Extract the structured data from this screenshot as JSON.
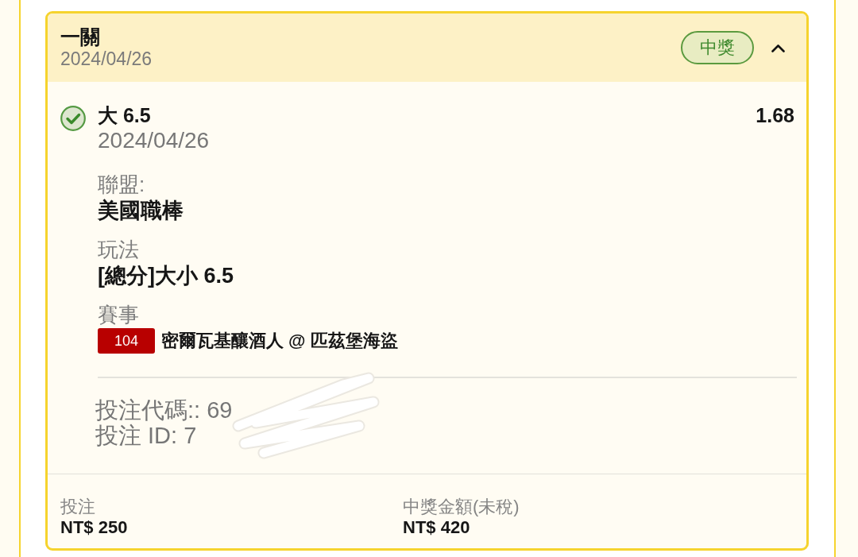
{
  "bet": {
    "type": "一關",
    "date": "2024/04/26",
    "status": "中獎",
    "expanded": true
  },
  "legs": [
    {
      "won": true,
      "selection": "大 6.5",
      "odds": "1.68",
      "date": "2024/04/26",
      "fields": [
        {
          "label": "聯盟:",
          "value": "美國職棒"
        },
        {
          "label": "玩法",
          "value": "[總分]大小 6.5"
        }
      ],
      "event": {
        "label": "賽事",
        "number": "104",
        "teams": "密爾瓦基釀酒人 @ 匹茲堡海盜"
      }
    }
  ],
  "codes": [
    "投注代碼:: 69",
    "投注 ID: 7"
  ],
  "summary": [
    {
      "label": "投注",
      "value": "NT$ 250"
    },
    {
      "label": "中獎金額(未稅)",
      "value": "NT$ 420"
    }
  ]
}
